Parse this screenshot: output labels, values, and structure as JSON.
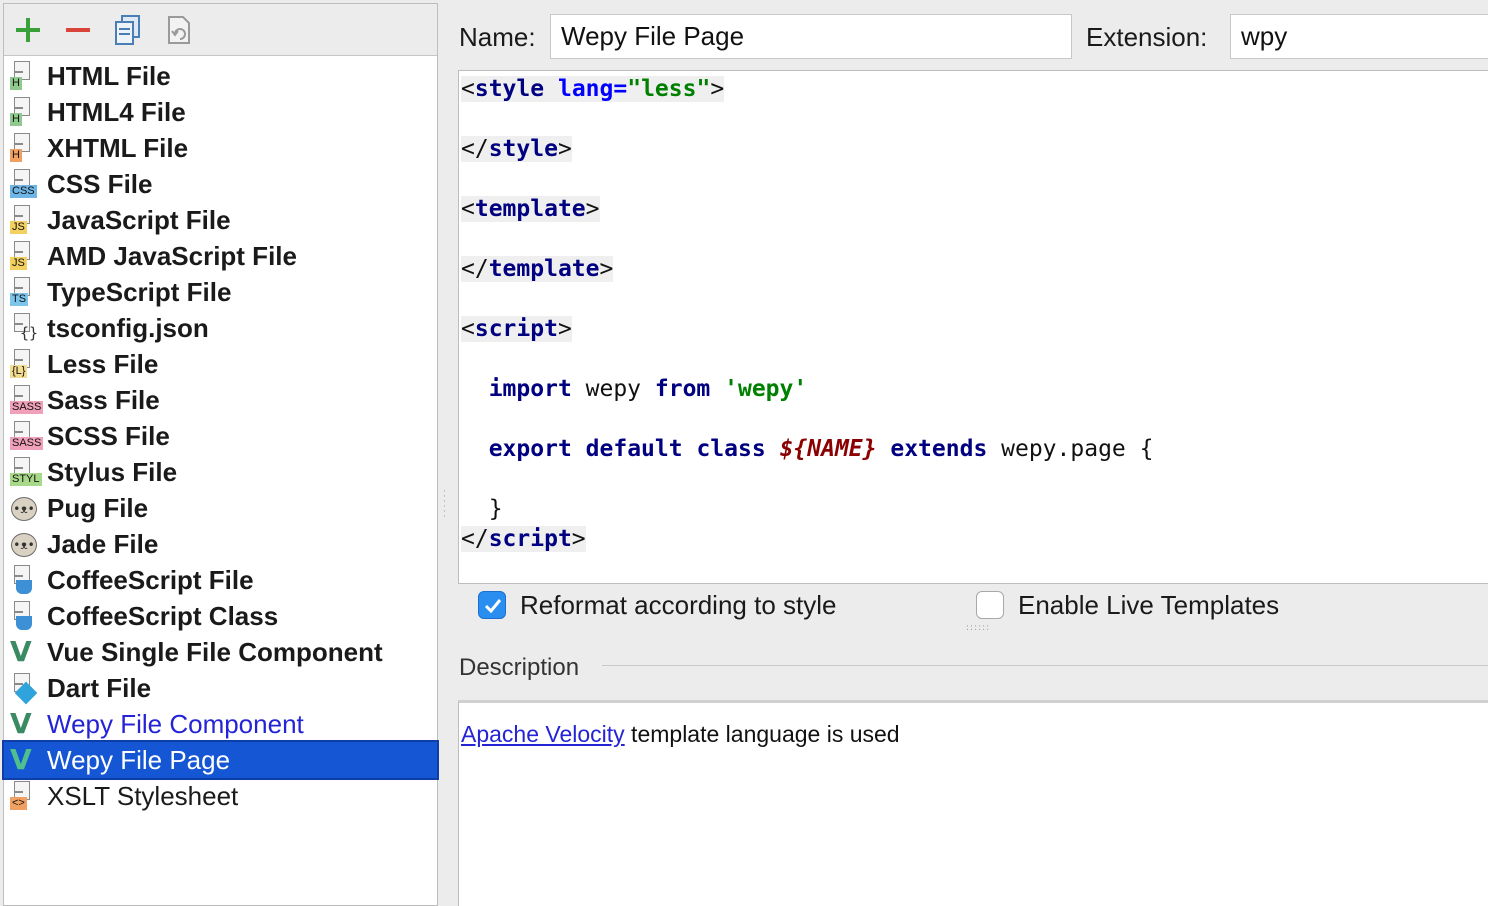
{
  "toolbar": {
    "add_icon": "plus-icon",
    "remove_icon": "minus-icon",
    "copy_icon": "copy-icon",
    "reset_icon": "reset-icon",
    "colors": {
      "add": "#3aa13a",
      "remove": "#d9443a",
      "copy": "#4a7fb5",
      "reset": "#9a9a9a"
    }
  },
  "files": [
    {
      "label": "HTML File",
      "icon": "html-file-icon",
      "badge": "H",
      "badge_color": "#8fc98f",
      "style": "bold"
    },
    {
      "label": "HTML4 File",
      "icon": "html4-file-icon",
      "badge": "H",
      "badge_color": "#8fc98f",
      "style": "bold"
    },
    {
      "label": "XHTML File",
      "icon": "xhtml-file-icon",
      "badge": "H",
      "badge_color": "#f0a060",
      "style": "bold"
    },
    {
      "label": "CSS File",
      "icon": "css-file-icon",
      "badge": "CSS",
      "badge_color": "#6fb6e6",
      "style": "bold"
    },
    {
      "label": "JavaScript File",
      "icon": "javascript-file-icon",
      "badge": "JS",
      "badge_color": "#f3d060",
      "style": "bold"
    },
    {
      "label": "AMD JavaScript File",
      "icon": "amd-javascript-file-icon",
      "badge": "JS",
      "badge_color": "#f3d060",
      "style": "bold"
    },
    {
      "label": "TypeScript File",
      "icon": "typescript-file-icon",
      "badge": "TS",
      "badge_color": "#7cc4ea",
      "style": "bold"
    },
    {
      "label": "tsconfig.json",
      "icon": "json-config-icon",
      "badge": "",
      "badge_color": "",
      "style": "bold"
    },
    {
      "label": "Less File",
      "icon": "less-file-icon",
      "badge": "{L}",
      "badge_color": "#f2dc90",
      "style": "bold"
    },
    {
      "label": "Sass File",
      "icon": "sass-file-icon",
      "badge": "SASS",
      "badge_color": "#f0a0b8",
      "style": "bold"
    },
    {
      "label": "SCSS File",
      "icon": "scss-file-icon",
      "badge": "SASS",
      "badge_color": "#f0a0b8",
      "style": "bold"
    },
    {
      "label": "Stylus File",
      "icon": "stylus-file-icon",
      "badge": "STYL",
      "badge_color": "#a8d88a",
      "style": "bold"
    },
    {
      "label": "Pug File",
      "icon": "pug-file-icon",
      "badge": "",
      "badge_color": "",
      "style": "bold"
    },
    {
      "label": "Jade File",
      "icon": "jade-file-icon",
      "badge": "",
      "badge_color": "",
      "style": "bold"
    },
    {
      "label": "CoffeeScript File",
      "icon": "coffeescript-file-icon",
      "badge": "",
      "badge_color": "",
      "style": "bold"
    },
    {
      "label": "CoffeeScript Class",
      "icon": "coffeescript-class-icon",
      "badge": "",
      "badge_color": "",
      "style": "bold"
    },
    {
      "label": "Vue Single File Component",
      "icon": "vue-icon",
      "badge": "",
      "badge_color": "",
      "style": "bold"
    },
    {
      "label": "Dart File",
      "icon": "dart-file-icon",
      "badge": "",
      "badge_color": "",
      "style": "bold"
    },
    {
      "label": "Wepy File Component",
      "icon": "vue-icon",
      "badge": "",
      "badge_color": "",
      "style": "link"
    },
    {
      "label": "Wepy File Page",
      "icon": "vue-icon",
      "badge": "",
      "badge_color": "",
      "style": "selected"
    },
    {
      "label": "XSLT Stylesheet",
      "icon": "xslt-file-icon",
      "badge": "<>",
      "badge_color": "#f0a060",
      "style": "normal"
    }
  ],
  "form": {
    "name_label": "Name:",
    "name_value": "Wepy File Page",
    "extension_label": "Extension:",
    "extension_value": "wpy"
  },
  "code": {
    "l1_lt": "<",
    "l1_tag": "style",
    "l1_sp": " ",
    "l1_attr": "lang=",
    "l1_val": "\"less\"",
    "l1_gt": ">",
    "l2_lt": "</",
    "l2_tag": "style",
    "l2_gt": ">",
    "l3_lt": "<",
    "l3_tag": "template",
    "l3_gt": ">",
    "l4_lt": "</",
    "l4_tag": "template",
    "l4_gt": ">",
    "l5_lt": "<",
    "l5_tag": "script",
    "l5_gt": ">",
    "l6_indent": "  ",
    "l6_kw1": "import",
    "l6_t1": " wepy ",
    "l6_kw2": "from",
    "l6_sp": " ",
    "l6_str": "'wepy'",
    "l7_indent": "  ",
    "l7_kw1": "export",
    "l7_sp1": " ",
    "l7_kw2": "default",
    "l7_sp2": " ",
    "l7_kw3": "class",
    "l7_sp3": " ",
    "l7_var": "${NAME}",
    "l7_sp4": " ",
    "l7_kw4": "extends",
    "l7_t": " wepy.page {",
    "l8_text": "  }",
    "l9_lt": "</",
    "l9_tag": "script",
    "l9_gt": ">"
  },
  "options": {
    "reformat_label": "Reformat according to style",
    "reformat_checked": true,
    "live_templates_label": "Enable Live Templates",
    "live_templates_checked": false
  },
  "description": {
    "heading": "Description",
    "link_text": "Apache Velocity",
    "text": " template language is used"
  }
}
